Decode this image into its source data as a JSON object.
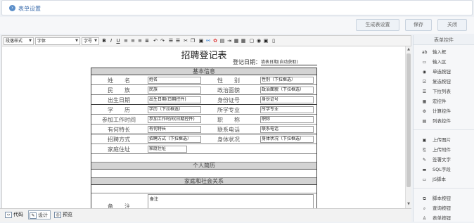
{
  "header": {
    "icon": "circle-arrow-icon",
    "title": "表单设置"
  },
  "actions": {
    "generate": "生成表设置",
    "save": "保存",
    "close": "关闭"
  },
  "toolbar": {
    "paragraph": "段落样式",
    "font": "字体",
    "size": "字号"
  },
  "form": {
    "title": "招聘登记表",
    "fill_label": "登记日期：",
    "fill_value": "填表日期(自动获取)",
    "sections": {
      "basic": "基本信息",
      "resume": "个人简历",
      "family": "家庭和社会关系"
    },
    "rows": [
      {
        "l1": "姓　　名",
        "v1": "姓名",
        "l2": "性　　别",
        "v2": "性别（下拉框选）"
      },
      {
        "l1": "民　　族",
        "v1": "民族",
        "l2": "政治面貌",
        "v2": "政治面貌（下拉框选）"
      },
      {
        "l1": "出生日期",
        "v1": "出生日期(日期控件)",
        "l2": "身份证号",
        "v2": "身份证号"
      },
      {
        "l1": "学　　历",
        "v1": "学历（下拉框选）",
        "l2": "所学专业",
        "v2": "所学专业"
      },
      {
        "l1": "参加工作时间",
        "v1": "参加工作时间(日期控件)",
        "l2": "职　　称",
        "v2": "职称"
      },
      {
        "l1": "有何特长",
        "v1": "有何特长",
        "l2": "联系电话",
        "v2": "联系电话"
      },
      {
        "l1": "招聘方式",
        "v1": "招聘方式（下拉框选）",
        "l2": "身体状况",
        "v2": "身体状况（下拉框选）"
      }
    ],
    "address_label": "家庭住址",
    "address_value": "家庭住址",
    "remark_label": "备　　注",
    "remark_value": "备注"
  },
  "footer_tabs": [
    {
      "icon": "code-icon",
      "label": "代码"
    },
    {
      "icon": "design-icon",
      "label": "设计"
    },
    {
      "icon": "preview-icon",
      "label": "预览"
    }
  ],
  "sidebar": {
    "title": "表单控件",
    "items": [
      {
        "icon": "text-input-icon",
        "label": "输入框"
      },
      {
        "icon": "textarea-icon",
        "label": "输入区"
      },
      {
        "icon": "radio-icon",
        "label": "单选按钮"
      },
      {
        "icon": "checkbox-icon",
        "label": "复选按钮"
      },
      {
        "icon": "select-icon",
        "label": "下拉列表"
      },
      {
        "icon": "macro-icon",
        "label": "宏控件"
      },
      {
        "icon": "gear-icon",
        "label": "计算控件"
      },
      {
        "icon": "list-icon",
        "label": "列表控件"
      },
      {
        "icon": "upload-image-icon",
        "label": "上传图片"
      },
      {
        "icon": "upload-file-icon",
        "label": "上传附件"
      },
      {
        "icon": "signature-icon",
        "label": "签署文字"
      },
      {
        "icon": "sql-icon",
        "label": "SQL字段"
      },
      {
        "icon": "js-icon",
        "label": "JS脚本"
      },
      {
        "icon": "script-button-icon",
        "label": "脚本按钮"
      },
      {
        "icon": "query-button-icon",
        "label": "查询按钮"
      },
      {
        "icon": "form-button-icon",
        "label": "表单按钮"
      }
    ]
  }
}
